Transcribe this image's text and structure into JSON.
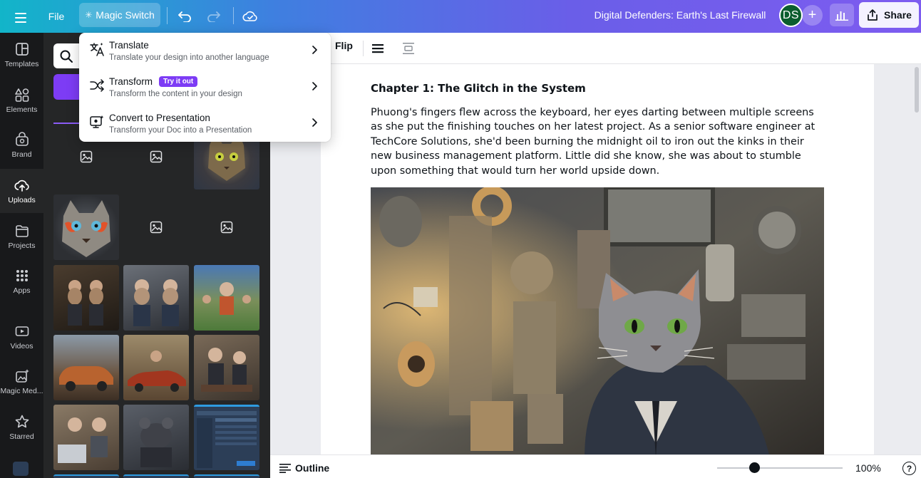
{
  "topbar": {
    "file_label": "File",
    "magic_switch_label": "Magic Switch",
    "doc_title": "Digital Defenders: Earth's Last Firewall",
    "avatar_initials": "DS",
    "share_label": "Share",
    "brand_gradient": [
      "#12b5c9",
      "#3f7fe0",
      "#7d5cf0"
    ]
  },
  "rail": {
    "items": [
      {
        "label": "Templates",
        "icon": "templates-icon"
      },
      {
        "label": "Elements",
        "icon": "elements-icon"
      },
      {
        "label": "Brand",
        "icon": "brand-icon"
      },
      {
        "label": "Uploads",
        "icon": "uploads-icon"
      },
      {
        "label": "Projects",
        "icon": "projects-icon"
      },
      {
        "label": "Apps",
        "icon": "apps-icon"
      },
      {
        "label": "Videos",
        "icon": "videos-icon"
      },
      {
        "label": "Magic Med...",
        "icon": "magic-media-icon"
      },
      {
        "label": "Starred",
        "icon": "starred-icon"
      }
    ],
    "active_index": 3
  },
  "dropdown": {
    "items": [
      {
        "title": "Translate",
        "subtitle": "Translate your design into another language",
        "icon": "translate-icon"
      },
      {
        "title": "Transform",
        "badge": "Try it out",
        "subtitle": "Transform the content in your design",
        "icon": "shuffle-icon"
      },
      {
        "title": "Convert to Presentation",
        "subtitle": "Transform your Doc into a Presentation",
        "icon": "presentation-icon"
      }
    ]
  },
  "editor_toolbar": {
    "flip_label": "Flip"
  },
  "document": {
    "chapter_title": "Chapter 1: The Glitch in the System",
    "paragraph": "Phuong's fingers flew across the keyboard, her eyes darting between multiple screens as she put the finishing touches on her latest project. As a senior software engineer at TechCore Solutions, she'd been burning the midnight oil to iron out the kinks in their new business management platform. Little did she know, she was about to stumble upon something that would turn her world upside down."
  },
  "bottombar": {
    "outline_label": "Outline",
    "zoom_label": "100%",
    "zoom_level": 0.3,
    "help_label": "?"
  },
  "colors": {
    "accent": "#7d3cf5",
    "rail_bg": "#18191b",
    "panel_bg": "#252627"
  }
}
